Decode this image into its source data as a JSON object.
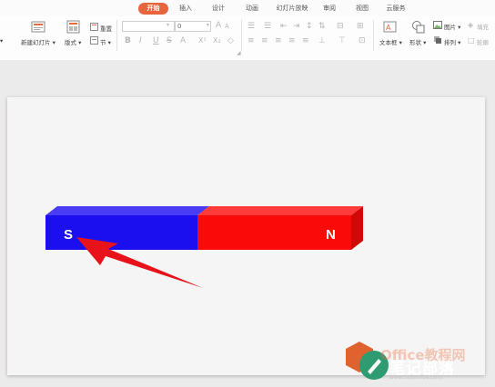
{
  "tabs": [
    {
      "label": "开始",
      "active": true
    },
    {
      "label": "插入"
    },
    {
      "label": "设计"
    },
    {
      "label": "动画"
    },
    {
      "label": "幻灯片放映"
    },
    {
      "label": "审阅"
    },
    {
      "label": "视图"
    },
    {
      "label": "云服务"
    }
  ],
  "ribbon": {
    "new_slide": "新建幻灯片",
    "layout": "版式",
    "reset": "重置",
    "section": "节",
    "font_name_value": "",
    "font_size_value": "0",
    "format_b": "B",
    "format_i": "I",
    "format_u": "U",
    "format_s": "S",
    "text_box": "文本框",
    "shape": "形状",
    "picture": "图片",
    "arrange": "排列",
    "fill": "填充",
    "outline": "轮廓"
  },
  "slide": {
    "pole_s": "S",
    "pole_n": "N",
    "colors": {
      "south_front": "#1b0eef",
      "south_top": "#4a3cf5",
      "north_front": "#fb0a0a",
      "north_top": "#ff3a3a",
      "north_side": "#cf0808",
      "arrow": "#e8121a"
    }
  },
  "watermark": {
    "title": "笔记部落",
    "url": "www.notetribe.com",
    "brand": "Office教程网"
  }
}
